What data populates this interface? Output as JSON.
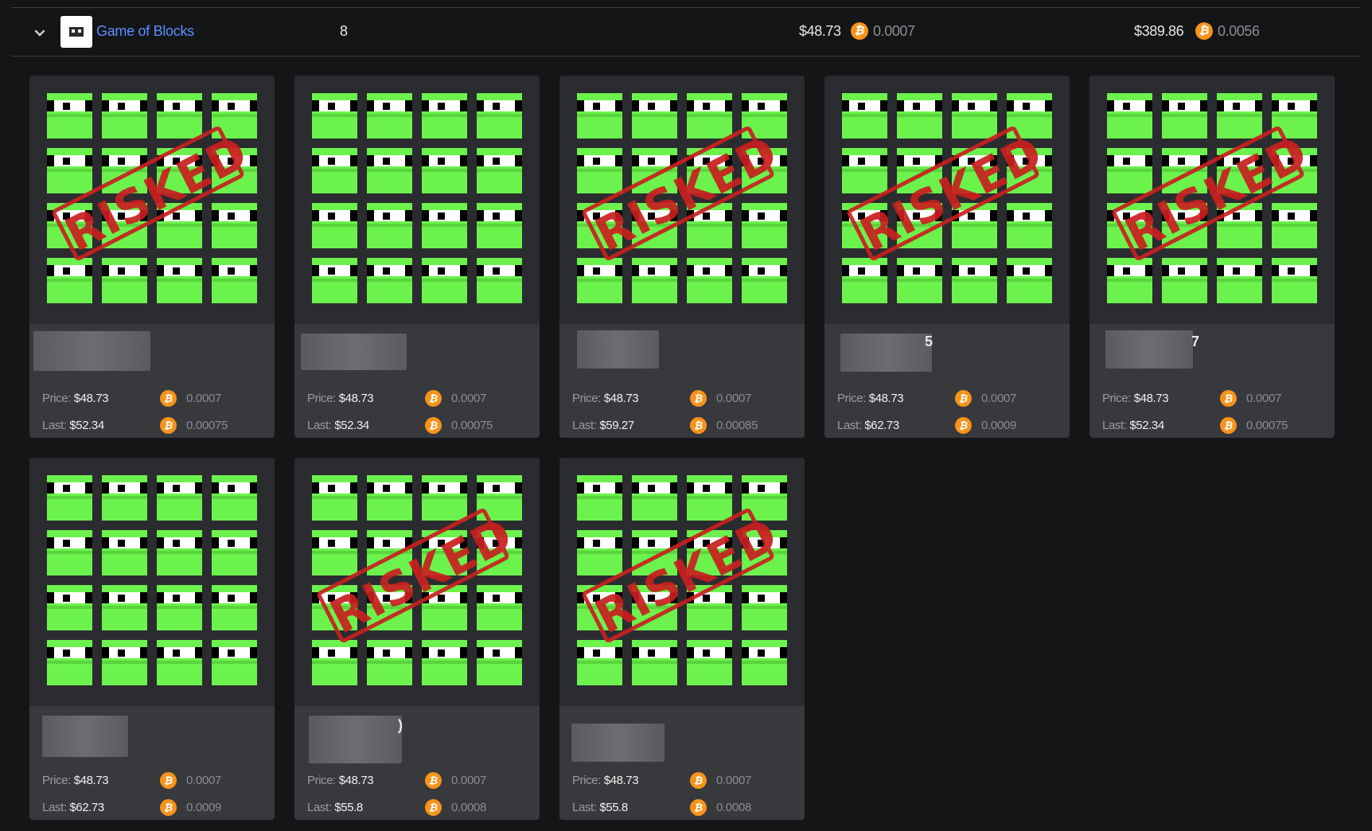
{
  "collection": {
    "name": "Game of Blocks",
    "count": "8",
    "floor_usd": "$48.73",
    "floor_btc": "0.0007",
    "total_usd": "$389.86",
    "total_btc": "0.0056"
  },
  "icons": {
    "coin": "bitcoin-coin-icon",
    "chevron": "chevron-down-icon"
  },
  "colors": {
    "accent": "#5b8dff",
    "btc": "#f7931a",
    "block_green": "#6cf24d",
    "stamp_red": "#c91f1f"
  },
  "labels": {
    "price": "Price:",
    "last": "Last:",
    "coin_glyph": "₿",
    "stamp": "RISKED"
  },
  "cards": [
    {
      "risked": true,
      "name_peek": "",
      "price_usd": "$48.73",
      "price_btc": "0.0007",
      "last_usd": "$52.34",
      "last_btc": "0.00075"
    },
    {
      "risked": false,
      "name_peek": "",
      "price_usd": "$48.73",
      "price_btc": "0.0007",
      "last_usd": "$52.34",
      "last_btc": "0.00075"
    },
    {
      "risked": true,
      "name_peek": "",
      "price_usd": "$48.73",
      "price_btc": "0.0007",
      "last_usd": "$59.27",
      "last_btc": "0.00085"
    },
    {
      "risked": true,
      "name_peek": "5",
      "price_usd": "$48.73",
      "price_btc": "0.0007",
      "last_usd": "$62.73",
      "last_btc": "0.0009"
    },
    {
      "risked": true,
      "name_peek": "7",
      "price_usd": "$48.73",
      "price_btc": "0.0007",
      "last_usd": "$52.34",
      "last_btc": "0.00075"
    },
    {
      "risked": false,
      "name_peek": "",
      "price_usd": "$48.73",
      "price_btc": "0.0007",
      "last_usd": "$62.73",
      "last_btc": "0.0009"
    },
    {
      "risked": true,
      "name_peek": ")",
      "price_usd": "$48.73",
      "price_btc": "0.0007",
      "last_usd": "$55.8",
      "last_btc": "0.0008"
    },
    {
      "risked": true,
      "name_peek": "",
      "price_usd": "$48.73",
      "price_btc": "0.0007",
      "last_usd": "$55.8",
      "last_btc": "0.0008"
    }
  ]
}
